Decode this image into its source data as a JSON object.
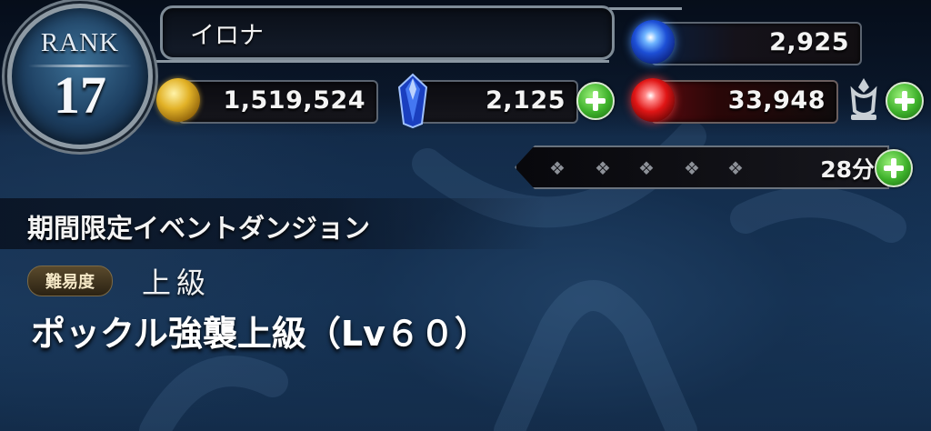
{
  "rank": {
    "label": "RANK",
    "value": "17"
  },
  "player": {
    "name": "イロナ"
  },
  "currencies": {
    "gold": {
      "icon": "gold-coin-icon",
      "value": "1,519,524"
    },
    "crystal": {
      "icon": "blue-crystal-icon",
      "value": "2,125"
    },
    "blue_orb": {
      "icon": "blue-orb-icon",
      "value": "2,925"
    },
    "red_orb": {
      "icon": "red-orb-icon",
      "value": "33,948"
    }
  },
  "stamina": {
    "icon": "stamina-gem-icon",
    "timer": "28分"
  },
  "dungeon": {
    "category": "期間限定イベントダンジョン",
    "difficulty_label": "難易度",
    "difficulty_value": "上級",
    "name": "ポックル強襲上級（Lv６０）"
  },
  "colors": {
    "accent_green": "#3db02a",
    "frame_silver": "#8a96a1",
    "background": "#143052"
  }
}
